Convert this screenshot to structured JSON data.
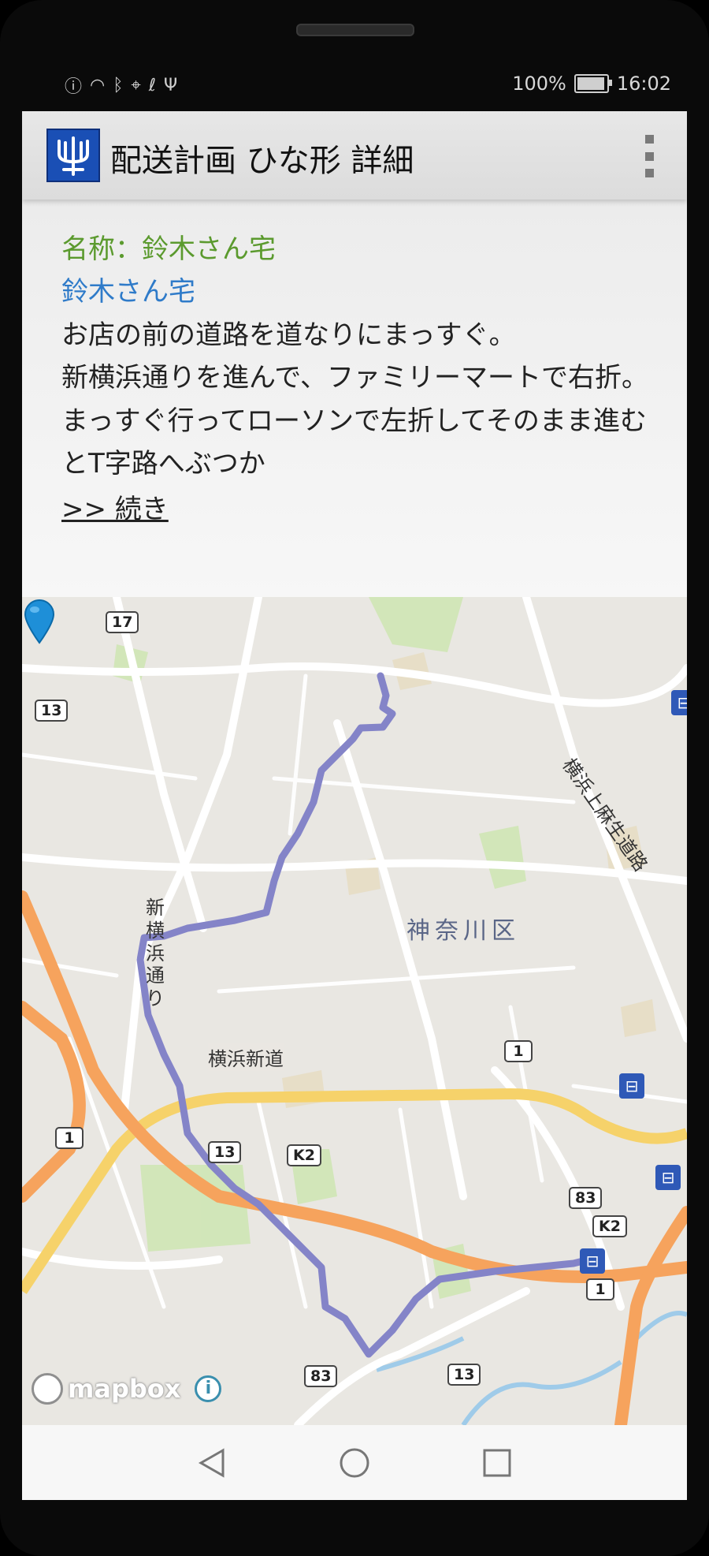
{
  "status_bar": {
    "icons": [
      "notification-icon",
      "wifi-icon",
      "bluetooth-icon",
      "location-icon",
      "sync-icon",
      "usb-icon"
    ],
    "battery_text": "100%",
    "time": "16:02"
  },
  "app_bar": {
    "title": "配送計画 ひな形 詳細",
    "logo": "trident-logo-icon",
    "menu": "overflow-menu-icon"
  },
  "detail": {
    "name_line": "名称：鈴木さん宅",
    "link_name": "鈴木さん宅",
    "memo": "お店の前の道路を道なりにまっすぐ。\n新横浜通りを進んで、ファミリーマートで右折。\nまっすぐ行ってローソンで左折してそのまま進むとT字路へぶつか",
    "more_link": ">> 続き"
  },
  "map": {
    "ward_label": "神奈川区",
    "road_yokohama_shindo": "横浜新道",
    "road_shinyokohama": "新横浜通り",
    "road_kamiasao": "横浜上麻生道路",
    "route_shields": [
      "17",
      "13",
      "1",
      "1",
      "83",
      "83",
      "13",
      "K2",
      "K2",
      "1",
      "13"
    ],
    "attribution": "mapbox",
    "info_icon": "i",
    "route_color": "#8484c8",
    "pin_color": "#1e8fd8"
  },
  "nav_bar": {
    "back": "back-icon",
    "home": "home-icon",
    "recents": "recents-icon"
  }
}
